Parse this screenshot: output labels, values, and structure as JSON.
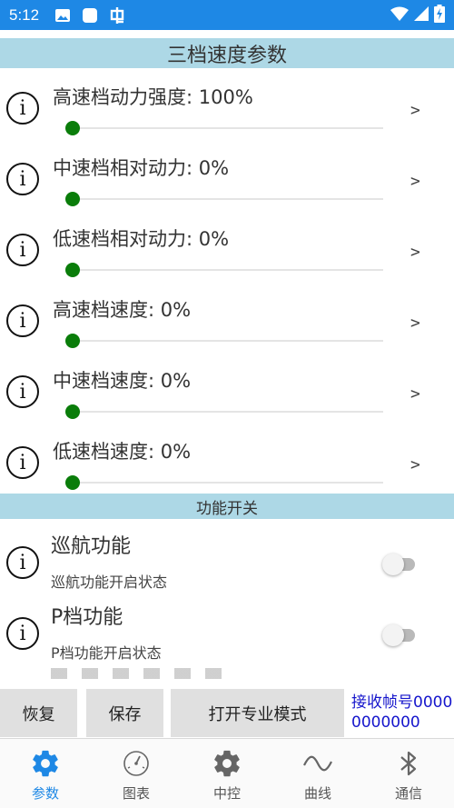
{
  "status_bar": {
    "time": "5:12",
    "icons": [
      "image-icon",
      "app-square-icon",
      "bug-icon"
    ],
    "right_icons": [
      "wifi-icon",
      "signal-icon",
      "battery-charging-icon"
    ]
  },
  "speed_section": {
    "title": "三档速度参数",
    "info_glyph": "i",
    "chevron": ">",
    "items": [
      {
        "label": "高速档动力强度: 100%",
        "value_percent": 0
      },
      {
        "label": "中速档相对动力: 0%",
        "value_percent": 0
      },
      {
        "label": "低速档相对动力: 0%",
        "value_percent": 0
      },
      {
        "label": "高速档速度: 0%",
        "value_percent": 0
      },
      {
        "label": "中速档速度: 0%",
        "value_percent": 0
      },
      {
        "label": "低速档速度: 0%",
        "value_percent": 0
      }
    ]
  },
  "function_section": {
    "title": "功能开关",
    "items": [
      {
        "title": "巡航功能",
        "subtitle": "巡航功能开启状态",
        "enabled": false
      },
      {
        "title": "P档功能",
        "subtitle": "P档功能开启状态",
        "enabled": false
      }
    ]
  },
  "actions": {
    "restore": "恢复",
    "save": "保存",
    "pro_mode": "打开专业模式",
    "frame_info": "接收帧号00000000000"
  },
  "bottom_nav": {
    "items": [
      {
        "label": "参数",
        "icon": "gear-icon",
        "active": true
      },
      {
        "label": "图表",
        "icon": "gauge-icon",
        "active": false
      },
      {
        "label": "中控",
        "icon": "gear-icon",
        "active": false
      },
      {
        "label": "曲线",
        "icon": "wave-icon",
        "active": false
      },
      {
        "label": "通信",
        "icon": "bluetooth-icon",
        "active": false
      }
    ]
  },
  "colors": {
    "status_bar": "#1e88e5",
    "section_header": "#add8e6",
    "slider_thumb": "#0a7d0a",
    "frame_info_text": "#1515cc",
    "nav_active": "#1e88e5"
  }
}
